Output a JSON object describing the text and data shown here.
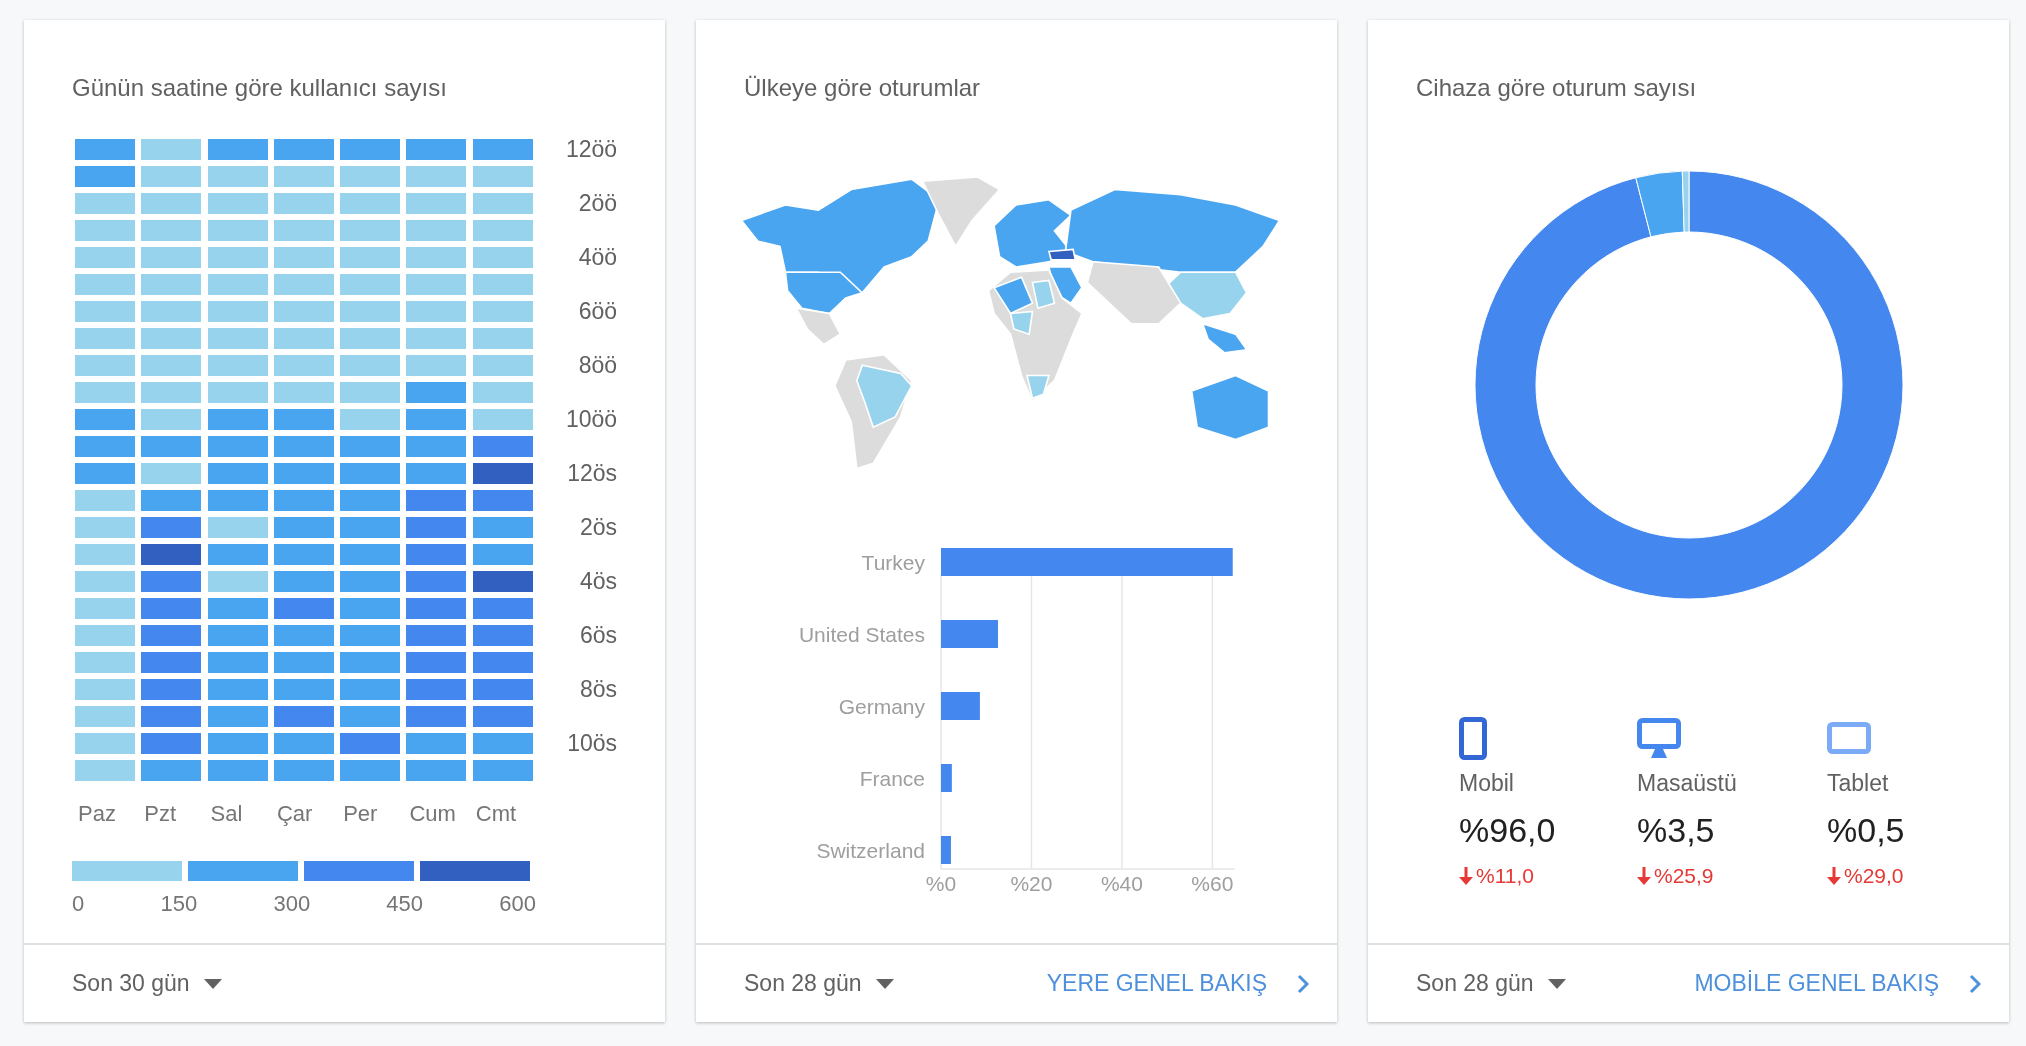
{
  "cards": [
    {
      "title": "Günün saatine göre kullanıcı sayısı",
      "kind": "heatmap",
      "heatmap": {
        "days": [
          "Paz",
          "Pzt",
          "Sal",
          "Çar",
          "Per",
          "Cum",
          "Cmt"
        ],
        "rows": [
          {
            "label": "12öö",
            "cells": [
              {
                "color": "#4aa5f0"
              },
              {
                "color": "#97d3ec"
              },
              {
                "color": "#4aa5f0"
              },
              {
                "color": "#4aa5f0"
              },
              {
                "color": "#4aa5f0"
              },
              {
                "color": "#4aa5f0"
              },
              {
                "color": "#4aa5f0"
              }
            ]
          },
          {
            "cells": [
              {
                "color": "#4aa5f0"
              },
              {
                "color": "#97d3ec"
              },
              {
                "color": "#97d3ec"
              },
              {
                "color": "#97d3ec"
              },
              {
                "color": "#97d3ec"
              },
              {
                "color": "#97d3ec"
              },
              {
                "color": "#97d3ec"
              }
            ]
          },
          {
            "label": "2öö",
            "cells": [
              {
                "color": "#97d3ec"
              },
              {
                "color": "#97d3ec"
              },
              {
                "color": "#97d3ec"
              },
              {
                "color": "#97d3ec"
              },
              {
                "color": "#97d3ec"
              },
              {
                "color": "#97d3ec"
              },
              {
                "color": "#97d3ec"
              }
            ]
          },
          {
            "cells": [
              {
                "color": "#97d3ec"
              },
              {
                "color": "#97d3ec"
              },
              {
                "color": "#97d3ec"
              },
              {
                "color": "#97d3ec"
              },
              {
                "color": "#97d3ec"
              },
              {
                "color": "#97d3ec"
              },
              {
                "color": "#97d3ec"
              }
            ]
          },
          {
            "label": "4öö",
            "cells": [
              {
                "color": "#97d3ec"
              },
              {
                "color": "#97d3ec"
              },
              {
                "color": "#97d3ec"
              },
              {
                "color": "#97d3ec"
              },
              {
                "color": "#97d3ec"
              },
              {
                "color": "#97d3ec"
              },
              {
                "color": "#97d3ec"
              }
            ]
          },
          {
            "cells": [
              {
                "color": "#97d3ec"
              },
              {
                "color": "#97d3ec"
              },
              {
                "color": "#97d3ec"
              },
              {
                "color": "#97d3ec"
              },
              {
                "color": "#97d3ec"
              },
              {
                "color": "#97d3ec"
              },
              {
                "color": "#97d3ec"
              }
            ]
          },
          {
            "label": "6öö",
            "cells": [
              {
                "color": "#97d3ec"
              },
              {
                "color": "#97d3ec"
              },
              {
                "color": "#97d3ec"
              },
              {
                "color": "#97d3ec"
              },
              {
                "color": "#97d3ec"
              },
              {
                "color": "#97d3ec"
              },
              {
                "color": "#97d3ec"
              }
            ]
          },
          {
            "cells": [
              {
                "color": "#97d3ec"
              },
              {
                "color": "#97d3ec"
              },
              {
                "color": "#97d3ec"
              },
              {
                "color": "#97d3ec"
              },
              {
                "color": "#97d3ec"
              },
              {
                "color": "#97d3ec"
              },
              {
                "color": "#97d3ec"
              }
            ]
          },
          {
            "label": "8öö",
            "cells": [
              {
                "color": "#97d3ec"
              },
              {
                "color": "#97d3ec"
              },
              {
                "color": "#97d3ec"
              },
              {
                "color": "#97d3ec"
              },
              {
                "color": "#97d3ec"
              },
              {
                "color": "#97d3ec"
              },
              {
                "color": "#97d3ec"
              }
            ]
          },
          {
            "cells": [
              {
                "color": "#97d3ec"
              },
              {
                "color": "#97d3ec"
              },
              {
                "color": "#97d3ec"
              },
              {
                "color": "#97d3ec"
              },
              {
                "color": "#97d3ec"
              },
              {
                "color": "#4aa5f0"
              },
              {
                "color": "#97d3ec"
              }
            ]
          },
          {
            "label": "10öö",
            "cells": [
              {
                "color": "#4aa5f0"
              },
              {
                "color": "#97d3ec"
              },
              {
                "color": "#4aa5f0"
              },
              {
                "color": "#4aa5f0"
              },
              {
                "color": "#97d3ec"
              },
              {
                "color": "#4aa5f0"
              },
              {
                "color": "#97d3ec"
              }
            ]
          },
          {
            "cells": [
              {
                "color": "#4aa5f0"
              },
              {
                "color": "#4aa5f0"
              },
              {
                "color": "#4aa5f0"
              },
              {
                "color": "#4aa5f0"
              },
              {
                "color": "#4aa5f0"
              },
              {
                "color": "#4aa5f0"
              },
              {
                "color": "#4487ee"
              }
            ]
          },
          {
            "label": "12ös",
            "cells": [
              {
                "color": "#4aa5f0"
              },
              {
                "color": "#97d3ec"
              },
              {
                "color": "#4aa5f0"
              },
              {
                "color": "#4aa5f0"
              },
              {
                "color": "#4aa5f0"
              },
              {
                "color": "#4aa5f0"
              },
              {
                "color": "#3160c0"
              }
            ]
          },
          {
            "cells": [
              {
                "color": "#97d3ec"
              },
              {
                "color": "#4aa5f0"
              },
              {
                "color": "#4aa5f0"
              },
              {
                "color": "#4aa5f0"
              },
              {
                "color": "#4aa5f0"
              },
              {
                "color": "#4487ee"
              },
              {
                "color": "#4487ee"
              }
            ]
          },
          {
            "label": "2ös",
            "cells": [
              {
                "color": "#97d3ec"
              },
              {
                "color": "#4487ee"
              },
              {
                "color": "#97d3ec"
              },
              {
                "color": "#4aa5f0"
              },
              {
                "color": "#4aa5f0"
              },
              {
                "color": "#4487ee"
              },
              {
                "color": "#4aa5f0"
              }
            ]
          },
          {
            "cells": [
              {
                "color": "#97d3ec"
              },
              {
                "color": "#3160c0"
              },
              {
                "color": "#4aa5f0"
              },
              {
                "color": "#4aa5f0"
              },
              {
                "color": "#4aa5f0"
              },
              {
                "color": "#4487ee"
              },
              {
                "color": "#4aa5f0"
              }
            ]
          },
          {
            "label": "4ös",
            "cells": [
              {
                "color": "#97d3ec"
              },
              {
                "color": "#4487ee"
              },
              {
                "color": "#97d3ec"
              },
              {
                "color": "#4aa5f0"
              },
              {
                "color": "#4aa5f0"
              },
              {
                "color": "#4487ee"
              },
              {
                "color": "#3160c0"
              }
            ]
          },
          {
            "cells": [
              {
                "color": "#97d3ec"
              },
              {
                "color": "#4487ee"
              },
              {
                "color": "#4aa5f0"
              },
              {
                "color": "#4487ee"
              },
              {
                "color": "#4aa5f0"
              },
              {
                "color": "#4487ee"
              },
              {
                "color": "#4487ee"
              }
            ]
          },
          {
            "label": "6ös",
            "cells": [
              {
                "color": "#97d3ec"
              },
              {
                "color": "#4487ee"
              },
              {
                "color": "#4aa5f0"
              },
              {
                "color": "#4aa5f0"
              },
              {
                "color": "#4aa5f0"
              },
              {
                "color": "#4487ee"
              },
              {
                "color": "#4487ee"
              }
            ]
          },
          {
            "cells": [
              {
                "color": "#97d3ec"
              },
              {
                "color": "#4487ee"
              },
              {
                "color": "#4aa5f0"
              },
              {
                "color": "#4aa5f0"
              },
              {
                "color": "#4aa5f0"
              },
              {
                "color": "#4487ee"
              },
              {
                "color": "#4487ee"
              }
            ]
          },
          {
            "label": "8ös",
            "cells": [
              {
                "color": "#97d3ec"
              },
              {
                "color": "#4487ee"
              },
              {
                "color": "#4aa5f0"
              },
              {
                "color": "#4aa5f0"
              },
              {
                "color": "#4aa5f0"
              },
              {
                "color": "#4487ee"
              },
              {
                "color": "#4487ee"
              }
            ]
          },
          {
            "cells": [
              {
                "color": "#97d3ec"
              },
              {
                "color": "#4487ee"
              },
              {
                "color": "#4aa5f0"
              },
              {
                "color": "#4487ee"
              },
              {
                "color": "#4aa5f0"
              },
              {
                "color": "#4487ee"
              },
              {
                "color": "#4487ee"
              }
            ]
          },
          {
            "label": "10ös",
            "cells": [
              {
                "color": "#97d3ec"
              },
              {
                "color": "#4487ee"
              },
              {
                "color": "#4aa5f0"
              },
              {
                "color": "#4aa5f0"
              },
              {
                "color": "#4487ee"
              },
              {
                "color": "#4aa5f0"
              },
              {
                "color": "#4aa5f0"
              }
            ]
          },
          {
            "cells": [
              {
                "color": "#97d3ec"
              },
              {
                "color": "#4aa5f0"
              },
              {
                "color": "#4aa5f0"
              },
              {
                "color": "#4aa5f0"
              },
              {
                "color": "#4aa5f0"
              },
              {
                "color": "#4aa5f0"
              },
              {
                "color": "#4aa5f0"
              }
            ]
          }
        ],
        "legend": {
          "swatches": [
            {
              "color": "#97d3ec"
            },
            {
              "color": "#4aa5f0"
            },
            {
              "color": "#4487ee"
            },
            {
              "color": "#3160c0"
            }
          ],
          "labels": [
            "0",
            "150",
            "300",
            "450",
            "600"
          ]
        }
      },
      "footer": {
        "period": "Son 30 gün"
      }
    },
    {
      "title": "Ülkeye göre oturumlar",
      "kind": "geo",
      "chart_data": {
        "type": "bar",
        "orientation": "horizontal",
        "grid": true,
        "categories": [
          "Turkey",
          "United States",
          "Germany",
          "France",
          "Switzerland"
        ],
        "series": [
          {
            "color": "#4487ee",
            "values": [
              64.5,
              12.6,
              8.6,
              2.4,
              2.2
            ]
          }
        ],
        "xlim": [
          0,
          65
        ],
        "xticks": [
          {
            "value": 0,
            "label": "%0"
          },
          {
            "value": 20,
            "label": "%20"
          },
          {
            "value": 40,
            "label": "%40"
          },
          {
            "value": 60,
            "label": "%60"
          }
        ]
      },
      "footer": {
        "period": "Son 28 gün",
        "link": "YERE GENEL BAKIŞ"
      }
    },
    {
      "title": "Cihaza göre oturum sayısı",
      "kind": "device",
      "chart_data": {
        "type": "donut",
        "categories": [
          "Mobil",
          "Masaüstü",
          "Tablet"
        ],
        "values": [
          96.0,
          3.5,
          0.5
        ],
        "colors": [
          "#4487ee",
          "#4aa5f0",
          "#97d3ec"
        ]
      },
      "devices": [
        {
          "kind": "phone",
          "value": "%96,0",
          "change": "%11,0",
          "decrease": true,
          "color": "#3367d6"
        },
        {
          "kind": "desktop",
          "value": "%3,5",
          "change": "%25,9",
          "decrease": true,
          "color": "#4487ee"
        },
        {
          "kind": "tablet",
          "value": "%0,5",
          "change": "%29,0",
          "decrease": true,
          "color": "#7baaf7"
        }
      ],
      "footer": {
        "period": "Son 28 gün",
        "link": "MOBİLE GENEL BAKIŞ"
      }
    }
  ]
}
